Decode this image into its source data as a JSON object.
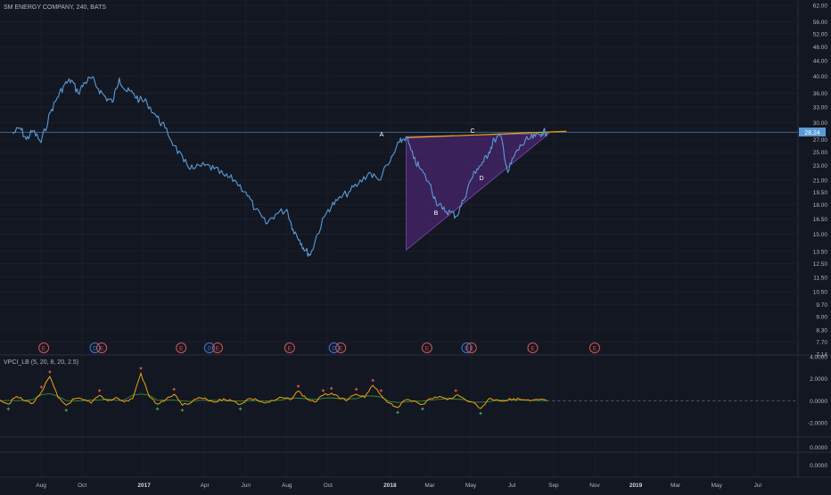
{
  "header": {
    "symbol_label": "SM ENERGY COMPANY, 240, BATS",
    "indicator_label": "VPCI_LB (5, 20, 8, 20, 2.5)"
  },
  "colors": {
    "background": "#131722",
    "price_line": "#5b9bd5",
    "grid": "#1e2230",
    "axis_text": "#b2b5be",
    "triangle_fill": "#5b2a86",
    "resistance_line": "#f0a30a",
    "vpci_line": "#f0a30a",
    "vpci_line2": "#3a8a3a",
    "event_red": "#d9534f",
    "event_blue": "#3a7bd5",
    "price_tag": "#5b9bd5"
  },
  "chart_data": [
    {
      "type": "line",
      "title": "SM ENERGY COMPANY, 240, BATS",
      "scale": "log",
      "y_ticks": [
        "62.00",
        "56.00",
        "52.00",
        "48.00",
        "44.00",
        "40.00",
        "36.00",
        "33.00",
        "30.00",
        "27.00",
        "25.00",
        "23.00",
        "21.00",
        "19.50",
        "18.00",
        "16.50",
        "15.00",
        "13.50",
        "12.50",
        "11.50",
        "10.50",
        "9.70",
        "9.00",
        "8.30",
        "7.70",
        "7.14"
      ],
      "x_ticks": [
        "Aug",
        "Oct",
        "2017",
        "Apr",
        "Jun",
        "Aug",
        "Oct",
        "2018",
        "Mar",
        "May",
        "Jul",
        "Sep",
        "Nov",
        "2019",
        "Mar",
        "May",
        "Jul"
      ],
      "last_price": "28.24",
      "series": [
        {
          "x": [
            "2016-06-20",
            "2016-07-01",
            "2016-07-10",
            "2016-07-20",
            "2016-08-01",
            "2016-08-15",
            "2016-08-25",
            "2016-09-05",
            "2016-09-15",
            "2016-09-25",
            "2016-10-05",
            "2016-10-15",
            "2016-10-25",
            "2016-11-05",
            "2016-11-15",
            "2016-11-25",
            "2016-12-05",
            "2016-12-15",
            "2016-12-25",
            "2017-01-05",
            "2017-01-20",
            "2017-02-01",
            "2017-02-15",
            "2017-03-01",
            "2017-03-15",
            "2017-04-01",
            "2017-04-15",
            "2017-05-01",
            "2017-05-15",
            "2017-06-01",
            "2017-06-15",
            "2017-07-01",
            "2017-07-15",
            "2017-08-01",
            "2017-08-10",
            "2017-08-20",
            "2017-08-28",
            "2017-09-05",
            "2017-09-15",
            "2017-10-01",
            "2017-10-15",
            "2017-11-01",
            "2017-11-15",
            "2017-12-01",
            "2017-12-15",
            "2018-01-01",
            "2018-01-15",
            "2018-01-25",
            "2018-02-05",
            "2018-02-15",
            "2018-03-01",
            "2018-03-10",
            "2018-03-20",
            "2018-04-01",
            "2018-04-10",
            "2018-04-20",
            "2018-05-01",
            "2018-05-10",
            "2018-05-20",
            "2018-05-28",
            "2018-06-05",
            "2018-06-15",
            "2018-06-25",
            "2018-07-05",
            "2018-07-15",
            "2018-07-25",
            "2018-08-05",
            "2018-08-15",
            "2018-08-22"
          ],
          "values": [
            28.0,
            29.0,
            27.0,
            28.5,
            26.5,
            32.0,
            35.0,
            38.0,
            39.0,
            36.0,
            38.5,
            39.5,
            37.0,
            35.0,
            34.0,
            39.5,
            36.5,
            36.0,
            34.5,
            34.0,
            31.0,
            29.0,
            26.0,
            23.5,
            22.5,
            23.0,
            22.5,
            21.5,
            21.0,
            19.5,
            17.5,
            16.0,
            17.0,
            17.5,
            15.5,
            14.5,
            13.6,
            13.2,
            15.0,
            17.5,
            18.5,
            19.5,
            20.5,
            22.0,
            21.0,
            23.5,
            26.5,
            27.5,
            24.0,
            22.5,
            20.5,
            18.5,
            17.5,
            17.2,
            16.8,
            18.5,
            21.0,
            22.5,
            23.5,
            25.0,
            27.0,
            27.5,
            22.0,
            24.5,
            26.0,
            27.0,
            27.5,
            28.2,
            28.24
          ]
        }
      ],
      "pattern_points": [
        "A",
        "B",
        "C",
        "D"
      ]
    },
    {
      "type": "line",
      "title": "VPCI_LB (5, 20, 8, 20, 2.5)",
      "y_ticks": [
        "4.0000",
        "2.0000",
        "0.0000",
        "-2.0000"
      ],
      "series": [
        {
          "values": [
            0.1,
            -0.3,
            0.4,
            0.0,
            -0.2,
            0.8,
            2.2,
            0.3,
            -0.4,
            0.2,
            0.1,
            -0.2,
            0.5,
            0.0,
            0.3,
            -0.1,
            0.2,
            2.5,
            0.4,
            -0.3,
            0.1,
            0.6,
            -0.4,
            -0.2,
            0.3,
            0.1,
            -0.1,
            0.2,
            0.0,
            -0.3,
            0.2,
            0.1,
            -0.2,
            0.0,
            0.3,
            0.1,
            0.9,
            0.2,
            -0.1,
            0.5,
            0.7,
            0.2,
            0.1,
            0.6,
            0.3,
            1.4,
            0.5,
            -0.2,
            -0.6,
            0.1,
            0.0,
            -0.3,
            0.2,
            0.4,
            0.1,
            0.5,
            0.2,
            -0.1,
            -0.7,
            0.2,
            0.1,
            0.0,
            0.2,
            0.1,
            0.0,
            0.1,
            0.0
          ]
        }
      ]
    },
    {
      "type": "line",
      "y_ticks": [
        "0.0000"
      ]
    },
    {
      "type": "line",
      "y_ticks": [
        "0.0000"
      ]
    }
  ],
  "events": [
    {
      "x": "2016-08-05",
      "label": "E",
      "kind": "earnings"
    },
    {
      "x": "2016-10-20",
      "label": "D",
      "kind": "dividend"
    },
    {
      "x": "2016-10-30",
      "label": "E",
      "kind": "earnings"
    },
    {
      "x": "2017-02-25",
      "label": "E",
      "kind": "earnings"
    },
    {
      "x": "2017-04-08",
      "label": "D",
      "kind": "dividend"
    },
    {
      "x": "2017-04-20",
      "label": "E",
      "kind": "earnings"
    },
    {
      "x": "2017-08-05",
      "label": "E",
      "kind": "earnings"
    },
    {
      "x": "2017-10-10",
      "label": "D",
      "kind": "dividend"
    },
    {
      "x": "2017-10-20",
      "label": "E",
      "kind": "earnings"
    },
    {
      "x": "2018-02-25",
      "label": "E",
      "kind": "earnings"
    },
    {
      "x": "2018-04-25",
      "label": "D",
      "kind": "dividend"
    },
    {
      "x": "2018-05-02",
      "label": "E",
      "kind": "earnings"
    },
    {
      "x": "2018-08-01",
      "label": "E",
      "kind": "earnings"
    },
    {
      "x": "2018-11-01",
      "label": "E",
      "kind": "earnings"
    }
  ]
}
